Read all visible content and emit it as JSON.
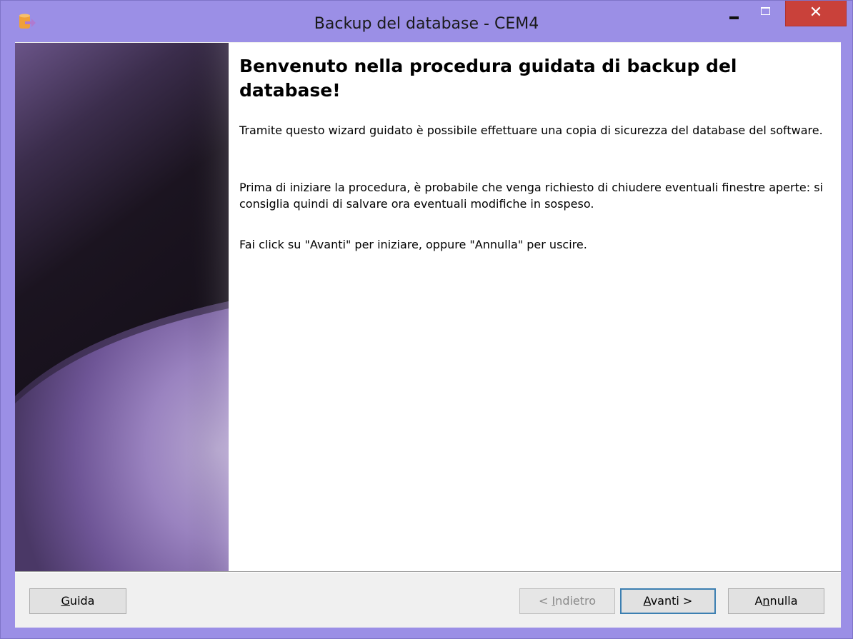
{
  "window": {
    "title": "Backup del database - CEM4",
    "close_glyph": "✕"
  },
  "content": {
    "heading": "Benvenuto nella procedura guidata di backup del database!",
    "paragraphs": [
      "Tramite questo wizard guidato è possibile effettuare una copia di sicurezza del database del software.",
      "Prima di iniziare la procedura, è probabile che venga richiesto di chiudere eventuali finestre aperte: si consiglia quindi di salvare ora eventuali modifiche in sospeso.",
      "Fai click su \"Avanti\" per iniziare, oppure \"Annulla\" per uscire."
    ]
  },
  "buttons": {
    "guida": {
      "mnemonic": "G",
      "rest": "uida"
    },
    "indietro": {
      "prefix": "< ",
      "mnemonic": "I",
      "rest": "ndietro"
    },
    "avanti": {
      "mnemonic": "A",
      "rest": "vanti >"
    },
    "annulla": {
      "prefix": "A",
      "mnemonic": "n",
      "rest": "nulla"
    }
  },
  "colors": {
    "titlebar": "#9b8fe6",
    "close_button": "#c9413a",
    "default_button_border": "#3c7fb1",
    "app_icon": "#f0a038"
  },
  "icons": {
    "app": "database-backup-icon",
    "minimize": "minimize-icon",
    "maximize": "maximize-icon",
    "close": "close-icon"
  }
}
